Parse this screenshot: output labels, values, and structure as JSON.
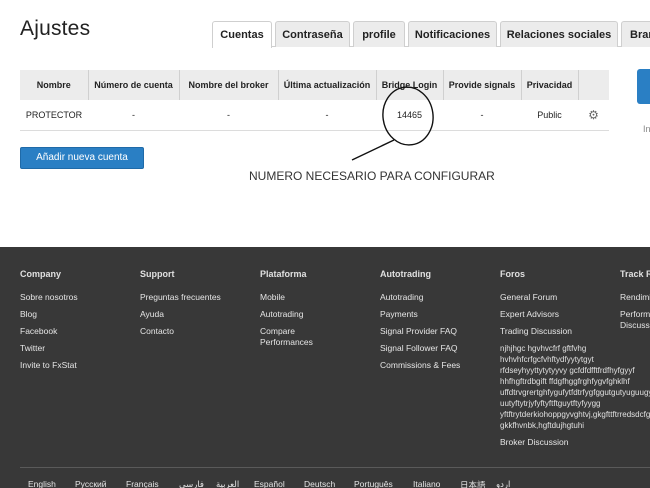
{
  "header": {
    "title": "Ajustes",
    "tabs": [
      {
        "label": "Cuentas",
        "active": true
      },
      {
        "label": "Contraseña",
        "active": false
      },
      {
        "label": "profile",
        "active": false
      },
      {
        "label": "Notificaciones",
        "active": false
      },
      {
        "label": "Relaciones sociales",
        "active": false
      },
      {
        "label": "Bran",
        "active": false
      }
    ]
  },
  "table": {
    "columns": [
      "Nombre",
      "Número de cuenta",
      "Nombre del broker",
      "Última actualización",
      "Bridge Login",
      "Provide signals",
      "Privacidad",
      ""
    ],
    "rows": [
      {
        "name": "PROTECTOR",
        "account_number": "-",
        "broker": "-",
        "last_update": "-",
        "bridge_login": "14465",
        "provide_signals": "-",
        "privacy": "Public"
      }
    ]
  },
  "add_account_button": "Añadir nueva cuenta",
  "side_text": "In",
  "annotation": {
    "text": "NUMERO NECESARIO PARA CONFIGURAR"
  },
  "footer": {
    "columns": [
      {
        "heading": "Company",
        "links": [
          "Sobre nosotros",
          "Blog",
          "Facebook",
          "Twitter",
          "Invite to FxStat"
        ]
      },
      {
        "heading": "Support",
        "links": [
          "Preguntas frecuentes",
          "Ayuda",
          "Contacto"
        ]
      },
      {
        "heading": "Plataforma",
        "links": [
          "Mobile",
          "Autotrading",
          "Compare Performances"
        ]
      },
      {
        "heading": "Autotrading",
        "links": [
          "Autotrading",
          "Payments",
          "Signal Provider FAQ",
          "Signal Follower FAQ",
          "Commissions & Fees"
        ]
      },
      {
        "heading": "Foros",
        "links": [
          "General Forum",
          "Expert Advisors",
          "Trading Discussion"
        ],
        "garbled_text": "njhjhgc hgvhvcfrf gftfvhg hvhvhfcrfgcfvhftydfyytytgyt rfdseyhyyttytytyyvy gcfdfdfftfrdfhyfgyyf hhfhgftrdbgift ffdgfhggfrghfygvfghklhf uffdtrvgrertghfygufytfdtrfygfggutgutyuguugyy uutyftytrjyfyftyftftguytftyfyygg yftftrytderkiohoppgyvghtvj,gkgfttftrredsdcfghjgkkfhvnbk,hgftdujhgtuhi",
        "after_link": "Broker Discussion"
      },
      {
        "heading": "Track R",
        "links": [
          "Rendimi",
          "Perform Discuss"
        ]
      }
    ],
    "languages": [
      "English",
      "Русский",
      "Français",
      "فارسی",
      "العربية",
      "Español",
      "Deutsch",
      "Português",
      "Italiano",
      "日本語",
      "اردو"
    ]
  }
}
